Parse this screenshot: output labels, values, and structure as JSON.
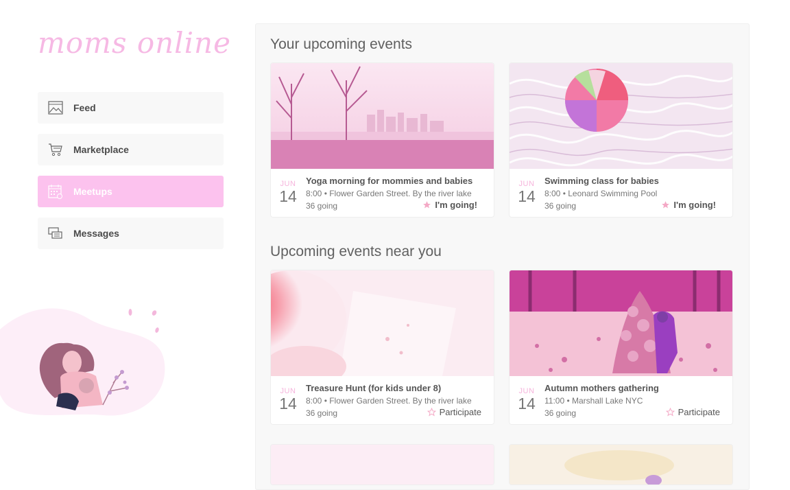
{
  "app": {
    "logo_text": "moms online"
  },
  "sidebar": {
    "items": [
      {
        "label": "Feed",
        "icon": "image-icon",
        "active": false
      },
      {
        "label": "Marketplace",
        "icon": "cart-icon",
        "active": false
      },
      {
        "label": "Meetups",
        "icon": "calendar-icon",
        "active": true
      },
      {
        "label": "Messages",
        "icon": "chat-icon",
        "active": false
      }
    ]
  },
  "colors": {
    "accent": "#fcc2ee",
    "logo": "#f6b9e4",
    "month": "#f6b4dc",
    "panel_bg": "#f8f8f8"
  },
  "sections": [
    {
      "title": "Your upcoming events",
      "events": [
        {
          "month": "JUN",
          "day": "14",
          "title": "Yoga morning for mommies and babies",
          "where": "8:00 • Flower Garden Street. By the river lake",
          "going": "36 going",
          "action": "I'm going!",
          "starred": true,
          "image": "park-skyline-image"
        },
        {
          "month": "JUN",
          "day": "14",
          "title": "Swimming class for babies",
          "where": "8:00 • Leonard Swimming Pool",
          "going": "36 going",
          "action": "I'm going!",
          "starred": true,
          "image": "pool-ball-image"
        }
      ]
    },
    {
      "title": "Upcoming events near you",
      "events": [
        {
          "month": "JUN",
          "day": "14",
          "title": "Treasure Hunt (for kids under 8)",
          "where": "8:00 • Flower Garden Street. By the river lake",
          "going": "36 going",
          "action": "Participate",
          "starred": false,
          "image": "child-image"
        },
        {
          "month": "JUN",
          "day": "14",
          "title": "Autumn mothers gathering",
          "where": "11:00 • Marshall Lake NYC",
          "going": "36 going",
          "action": "Participate",
          "starred": false,
          "image": "leaves-image"
        }
      ]
    }
  ]
}
